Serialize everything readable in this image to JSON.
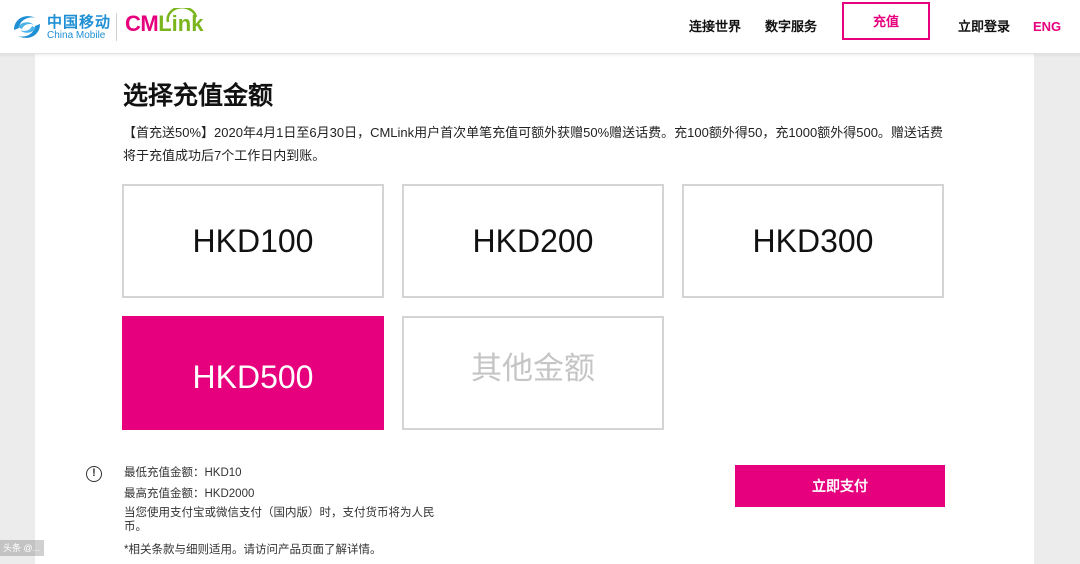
{
  "brand": {
    "cm_cn": "中国移动",
    "cm_en": "China Mobile",
    "cmlink_cm": "CM",
    "cmlink_link": "Link",
    "colors": {
      "primary": "#e6007e",
      "cm_blue": "#1e8fd4",
      "link_green": "#7ab51d"
    }
  },
  "nav": {
    "items": [
      {
        "label": "连接世界"
      },
      {
        "label": "数字服务"
      },
      {
        "label": "充值",
        "active": true
      },
      {
        "label": "立即登录"
      },
      {
        "label": "ENG"
      }
    ]
  },
  "main": {
    "title": "选择充值金额",
    "promo": "【首充送50%】2020年4月1日至6月30日，CMLink用户首次单笔充值可额外获赠50%赠送话费。充100额外得50，充1000额外得500。赠送话费将于充值成功后7个工作日内到账。",
    "amounts": [
      {
        "label": "HKD100"
      },
      {
        "label": "HKD200"
      },
      {
        "label": "HKD300"
      },
      {
        "label": "HKD500",
        "selected": true
      },
      {
        "label": "其他金额"
      }
    ],
    "notes": {
      "min": "最低充值金额：HKD10",
      "max": "最高充值金额：HKD2000",
      "alipay": "当您使用支付宝或微信支付（国内版）时，支付货币将为人民币。",
      "terms": "*相关条款与细则适用。请访问产品页面了解详情。"
    },
    "pay_button": "立即支付"
  },
  "icons": {
    "info": "info-circle-icon"
  },
  "watermark": "头条 @..."
}
